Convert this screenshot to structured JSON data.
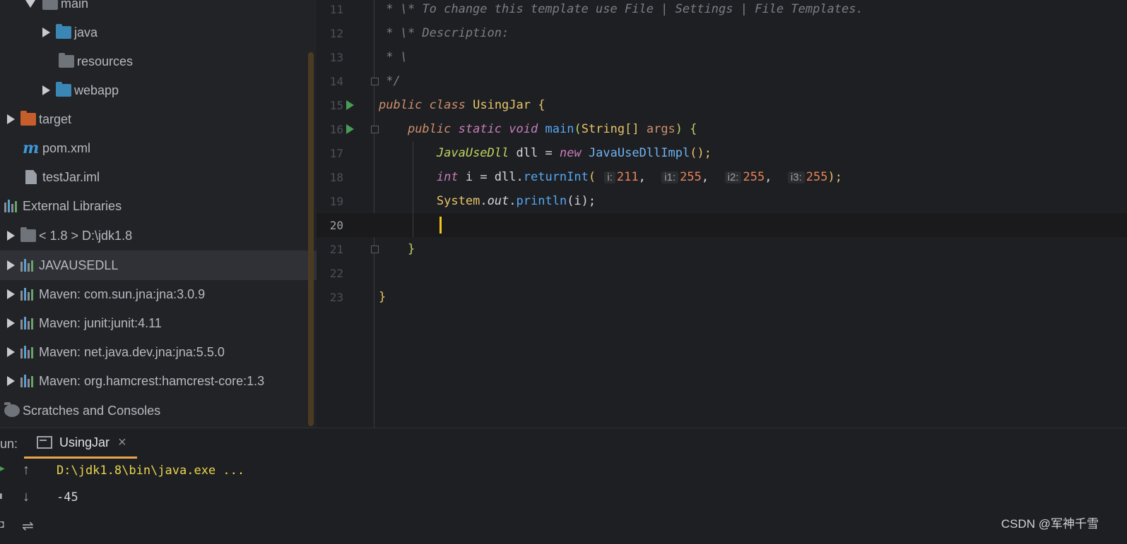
{
  "project_tree": {
    "items": [
      {
        "label": "main",
        "expanded": true
      },
      {
        "label": "java"
      },
      {
        "label": "resources"
      },
      {
        "label": "webapp"
      },
      {
        "label": "target"
      },
      {
        "label": "pom.xml"
      },
      {
        "label": "testJar.iml"
      },
      {
        "label": "External Libraries"
      },
      {
        "label": "< 1.8 >  D:\\jdk1.8"
      },
      {
        "label": "JAVAUSEDLL",
        "selected": true
      },
      {
        "label": "Maven: com.sun.jna:jna:3.0.9"
      },
      {
        "label": "Maven: junit:junit:4.11"
      },
      {
        "label": "Maven: net.java.dev.jna:jna:5.5.0"
      },
      {
        "label": "Maven: org.hamcrest:hamcrest-core:1.3"
      },
      {
        "label": "Scratches and Consoles"
      }
    ]
  },
  "editor": {
    "line_numbers": [
      "11",
      "12",
      "13",
      "14",
      "15",
      "16",
      "17",
      "18",
      "19",
      "20",
      "21",
      "22",
      "23"
    ],
    "current_line": "20",
    "lines": {
      "l11": " * \\* To change this template use File | Settings | File Templates.",
      "l12": " * \\* Description:",
      "l13": " * \\",
      "l14": " */",
      "l15_kw1": "public",
      "l15_kw2": "class",
      "l15_name": "UsingJar",
      "l15_brace": "{",
      "l16_kw1": "public",
      "l16_kw2": "static",
      "l16_kw3": "void",
      "l16_fn": "main",
      "l16_open": "(",
      "l16_type": "String[]",
      "l16_arg": "args",
      "l16_close": ")",
      "l16_brace": "{",
      "l17_type": "JavaUseDll",
      "l17_var": "dll",
      "l17_eq": "=",
      "l17_new": "new",
      "l17_impl": "JavaUseDllImpl",
      "l17_end": "();",
      "l18_kw": "int",
      "l18_rest": "i = dll.",
      "l18_fn": "returnInt",
      "l18_open": "(",
      "hints": [
        "i:",
        "i1:",
        "i2:",
        "i3:"
      ],
      "args": [
        "211",
        "255",
        "255",
        "255"
      ],
      "comma": ",",
      "l18_end": ");",
      "l19_sys": "System",
      "l19_dot": ".",
      "l19_out": "out",
      "l19_fn": "println",
      "l19_args": "(i);",
      "l21_brace": "}",
      "l23_brace": "}"
    }
  },
  "run_panel": {
    "label": "un:",
    "tab_label": "UsingJar",
    "close_glyph": "×",
    "console": [
      "D:\\jdk1.8\\bin\\java.exe ...",
      "-45"
    ],
    "colors": {
      "command": "#e8d44d",
      "output": "#d5d7dc",
      "tab_underline": "#e8a64a"
    }
  },
  "watermark": "CSDN @军神千雪"
}
